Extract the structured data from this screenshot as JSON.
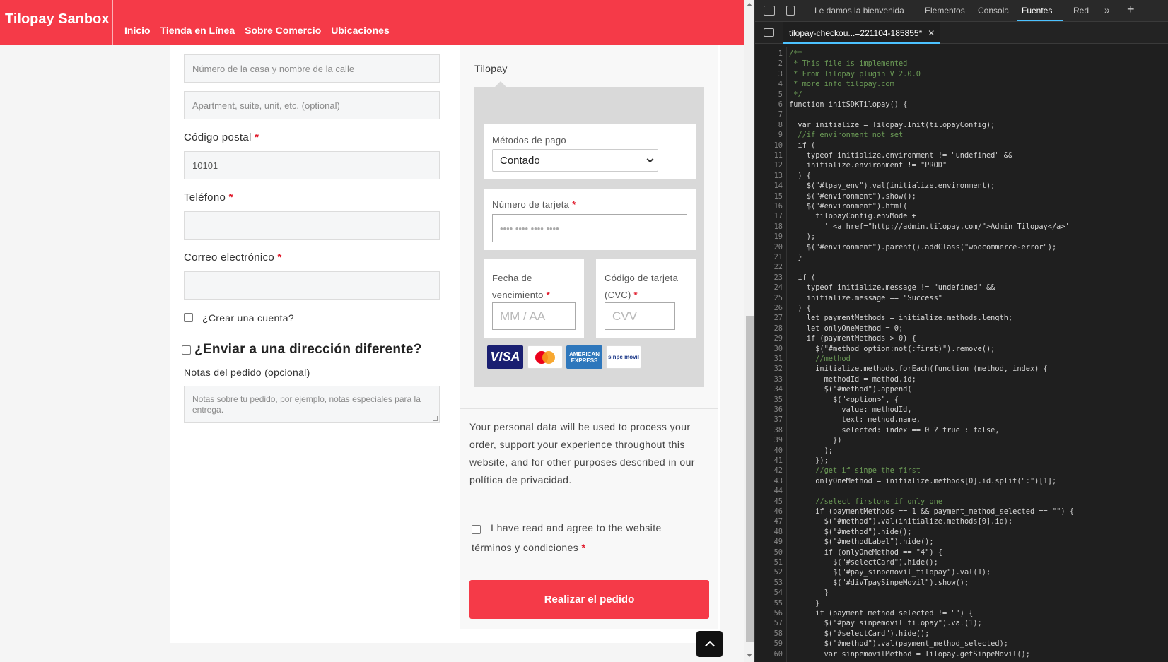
{
  "site": {
    "brand": "Tilopay Sanbox",
    "nav": [
      "Inicio",
      "Tienda en Línea",
      "Sobre Comercio",
      "Ubicaciones"
    ],
    "colors": {
      "accent": "#f53a48",
      "required": "#e01a2b"
    }
  },
  "form": {
    "street_placeholder": "Número de la casa y nombre de la calle",
    "apartment_placeholder": "Apartment, suite, unit, etc. (optional)",
    "postal_label": "Código postal",
    "postal_value": "10101",
    "phone_label": "Teléfono",
    "email_label": "Correo electrónico",
    "required_mark": "*",
    "create_account_label": "¿Crear una cuenta?",
    "ship_different_label": "¿Enviar a una dirección diferente?",
    "notes_label": "Notas del pedido (opcional)",
    "notes_placeholder": "Notas sobre tu pedido, por ejemplo, notas especiales para la entrega."
  },
  "payment": {
    "tab_label": "Tilopay",
    "methods_label": "Métodos de pago",
    "method_selected": "Contado",
    "card_number_label": "Número de tarjeta",
    "card_number_placeholder": "•••• •••• •••• ••••",
    "expiry_label_1": "Fecha de",
    "expiry_label_2": "vencimiento",
    "expiry_placeholder": "MM / AA",
    "cvc_label_1": "Código de tarjeta",
    "cvc_label_2": "(CVC)",
    "cvc_placeholder": "CVV",
    "logos": {
      "visa": "VISA",
      "amex": "AMERICAN EXPRESS",
      "sinpe": "sinpe móvil"
    },
    "privacy_text": "Your personal data will be used to process your order, support your experience throughout this website, and for other purposes described in our política de privacidad.",
    "terms_text_1": "I have read and agree to the website",
    "terms_text_2": "términos y condiciones",
    "order_button": "Realizar el pedido"
  },
  "devtools": {
    "tabs": [
      "Le damos la bienvenida",
      "Elementos",
      "Consola",
      "Fuentes",
      "Red"
    ],
    "active_tab": "Fuentes",
    "file_tab": "tilopay-checkou...=221104-185855*",
    "code_lines": [
      "/**",
      " * This file is implemented",
      " * From Tilopay plugin V 2.0.0",
      " * more info tilopay.com",
      " */",
      "function initSDKTilopay() {",
      "",
      "  var initialize = Tilopay.Init(tilopayConfig);",
      "  //if environment not set",
      "  if (",
      "    typeof initialize.environment != \"undefined\" &&",
      "    initialize.environment != \"PROD\"",
      "  ) {",
      "    $(\"#tpay_env\").val(initialize.environment);",
      "    $(\"#environment\").show();",
      "    $(\"#environment\").html(",
      "      tilopayConfig.envMode +",
      "        ' <a href=\"http://admin.tilopay.com/\">Admin Tilopay</a>'",
      "    );",
      "    $(\"#environment\").parent().addClass(\"woocommerce-error\");",
      "  }",
      "",
      "  if (",
      "    typeof initialize.message != \"undefined\" &&",
      "    initialize.message == \"Success\"",
      "  ) {",
      "    let paymentMethods = initialize.methods.length;",
      "    let onlyOneMethod = 0;",
      "    if (paymentMethods > 0) {",
      "      $(\"#method option:not(:first)\").remove();",
      "      //method",
      "      initialize.methods.forEach(function (method, index) {",
      "        methodId = method.id;",
      "        $(\"#method\").append(",
      "          $(\"<option>\", {",
      "            value: methodId,",
      "            text: method.name,",
      "            selected: index == 0 ? true : false,",
      "          })",
      "        );",
      "      });",
      "      //get if sinpe the first",
      "      onlyOneMethod = initialize.methods[0].id.split(\":\")[1];",
      "",
      "      //select firstone if only one",
      "      if (paymentMethods == 1 && payment_method_selected == \"\") {",
      "        $(\"#method\").val(initialize.methods[0].id);",
      "        $(\"#method\").hide();",
      "        $(\"#methodLabel\").hide();",
      "        if (onlyOneMethod == \"4\") {",
      "          $(\"#selectCard\").hide();",
      "          $(\"#pay_sinpemovil_tilopay\").val(1);",
      "          $(\"#divTpaySinpeMovil\").show();",
      "        }",
      "      }",
      "      if (payment_method_selected != \"\") {",
      "        $(\"#pay_sinpemovil_tilopay\").val(1);",
      "        $(\"#selectCard\").hide();",
      "        $(\"#method\").val(payment_method_selected);",
      "        var sinpemovilMethod = Tilopay.getSinpeMovil();"
    ]
  }
}
